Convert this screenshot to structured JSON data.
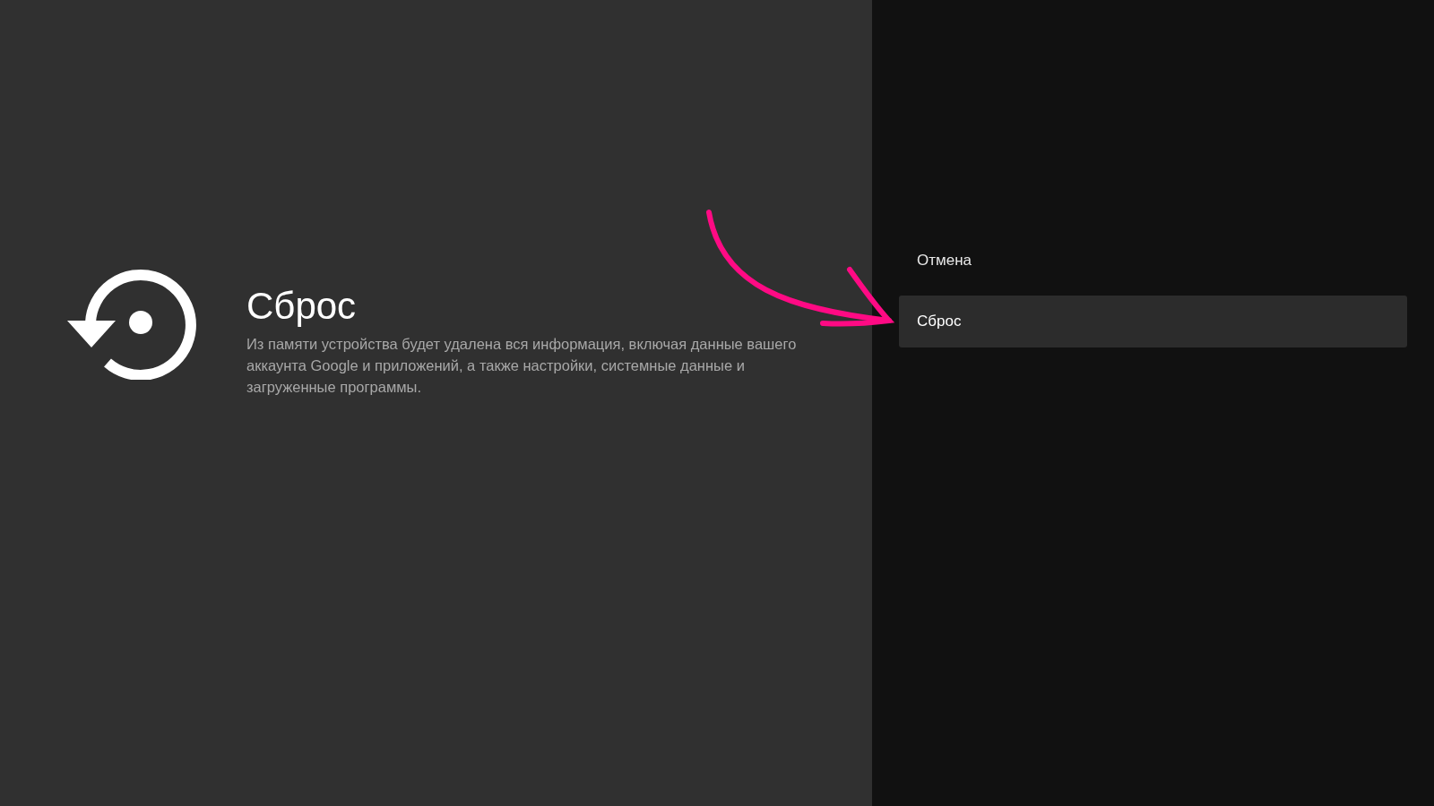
{
  "info": {
    "title": "Сброс",
    "description": "Из памяти устройства будет удалена вся информация, включая данные вашего аккаунта Google и приложений, а также настройки, системные данные и загруженные программы."
  },
  "actions": [
    {
      "label": "Отмена",
      "selected": false
    },
    {
      "label": "Сброс",
      "selected": true
    }
  ]
}
